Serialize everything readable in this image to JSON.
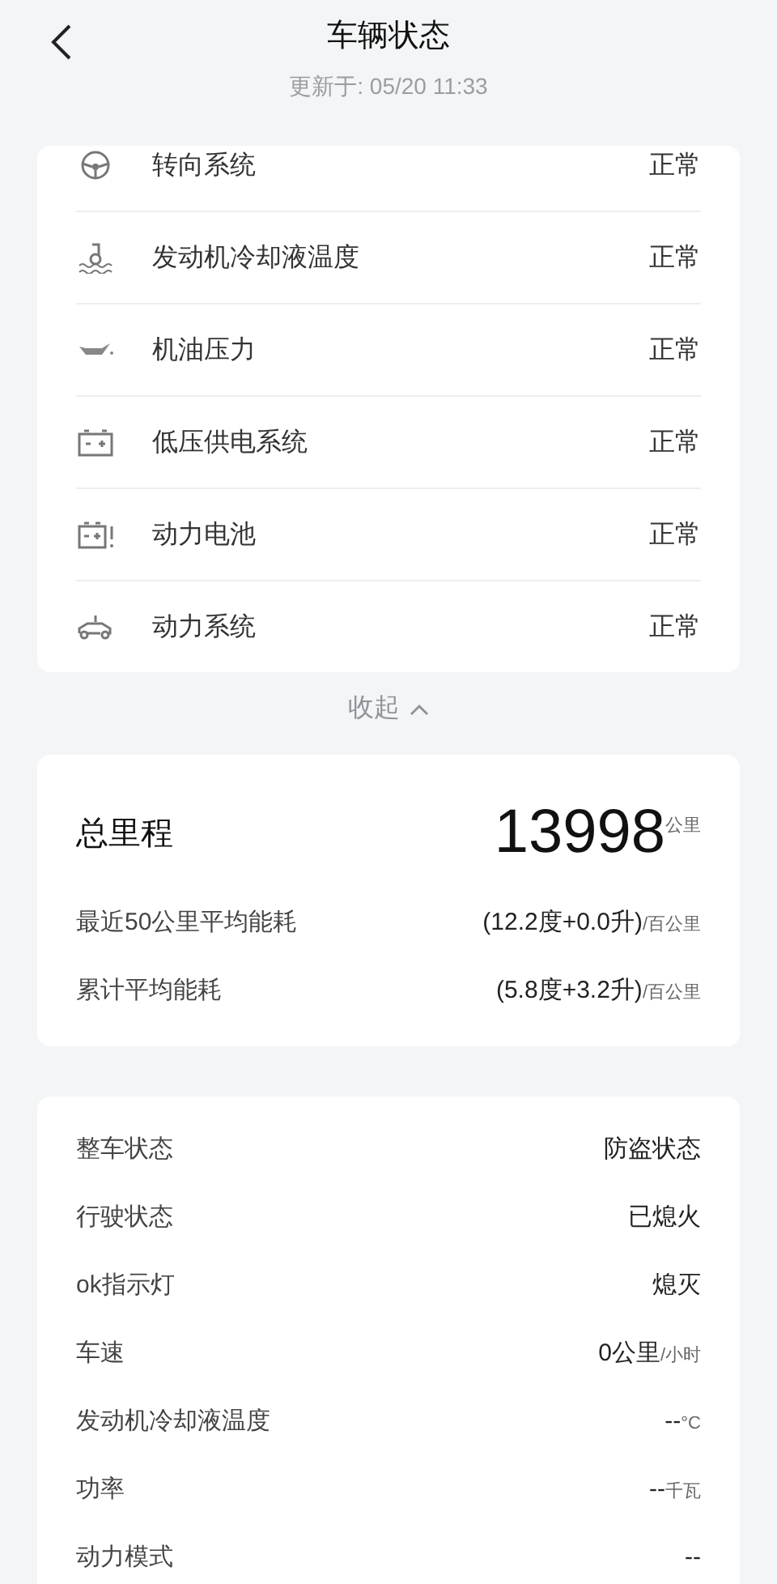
{
  "header": {
    "title": "车辆状态",
    "updated": "更新于: 05/20 11:33"
  },
  "systems": [
    {
      "name": "转向系统",
      "status": "正常"
    },
    {
      "name": "发动机冷却液温度",
      "status": "正常"
    },
    {
      "name": "机油压力",
      "status": "正常"
    },
    {
      "name": "低压供电系统",
      "status": "正常"
    },
    {
      "name": "动力电池",
      "status": "正常"
    },
    {
      "name": "动力系统",
      "status": "正常"
    }
  ],
  "collapse": {
    "label": "收起",
    "expanded": true
  },
  "mileage": {
    "label": "总里程",
    "value": "13998",
    "unit": "公里",
    "rows": [
      {
        "label": "最近50公里平均能耗",
        "value": "(12.2度+0.0升)",
        "unit": "/百公里"
      },
      {
        "label": "累计平均能耗",
        "value": "(5.8度+3.2升)",
        "unit": "/百公里"
      }
    ]
  },
  "details": [
    {
      "label": "整车状态",
      "value": "防盗状态"
    },
    {
      "label": "行驶状态",
      "value": "已熄火"
    },
    {
      "label": "ok指示灯",
      "value": "熄灭"
    },
    {
      "label": "车速",
      "value": "0公里",
      "unit": "/小时"
    },
    {
      "label": "发动机冷却液温度",
      "value": "--",
      "unit": "°C"
    },
    {
      "label": "功率",
      "value": "--",
      "unit": "千瓦"
    },
    {
      "label": "动力模式",
      "value": "--"
    }
  ]
}
